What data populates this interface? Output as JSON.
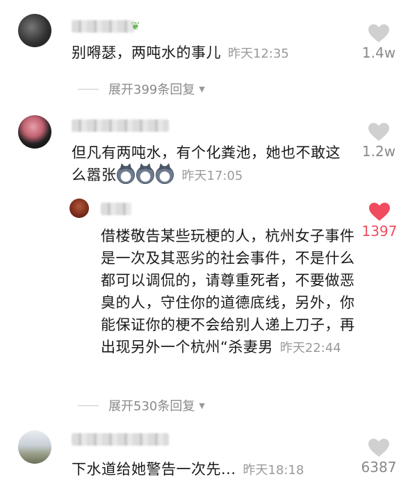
{
  "comments": [
    {
      "text": "别嘚瑟，两吨水的事儿",
      "time": "昨天12:35",
      "likes": "1.4w",
      "liked": false,
      "expand_label": "展开399条回复"
    },
    {
      "text": "但凡有两吨水，有个化粪池，她也不敢这么嚣张",
      "time": "昨天17:05",
      "likes": "1.2w",
      "liked": false
    },
    {
      "text": "借楼敬告某些玩梗的人，杭州女子事件是一次及其恶劣的社会事件，不是什么都可以调侃的，请尊重死者，不要做恶臭的人，守住你的道德底线，另外，你能保证你的梗不会给别人递上刀子，再出现另外一个杭州“杀妻男",
      "time": "昨天22:44",
      "likes": "1397",
      "liked": true,
      "expand_label": "展开530条回复"
    },
    {
      "text": "下水道给她警告一次先...",
      "time": "昨天18:18",
      "likes": "6387",
      "liked": false
    }
  ],
  "colors": {
    "liked_heart": "#f04b5f",
    "unliked_heart": "#d0d0d0",
    "meta_text": "#9a9a9a"
  },
  "icons": {
    "like": "heart-icon",
    "expand": "caret-down-icon",
    "emoji": "husky-emoji-icon"
  }
}
